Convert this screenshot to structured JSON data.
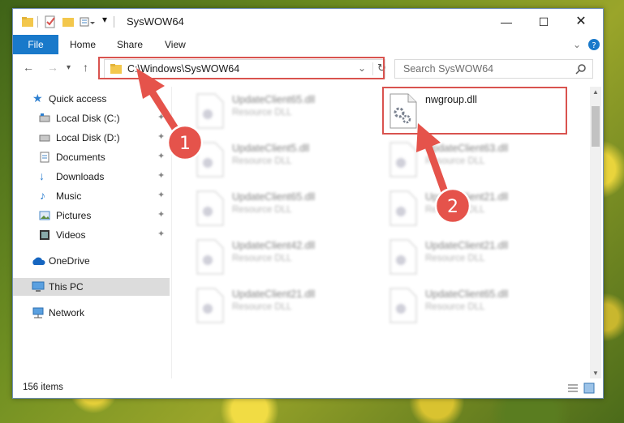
{
  "window": {
    "title": "SysWOW64"
  },
  "ribbon": {
    "file": "File",
    "home": "Home",
    "share": "Share",
    "view": "View"
  },
  "address": {
    "path": "C:\\Windows\\SysWOW64",
    "search_placeholder": "Search SysWOW64"
  },
  "sidebar": {
    "items": [
      {
        "label": "Quick access"
      },
      {
        "label": "Local Disk (C:)"
      },
      {
        "label": "Local Disk (D:)"
      },
      {
        "label": "Documents"
      },
      {
        "label": "Downloads"
      },
      {
        "label": "Music"
      },
      {
        "label": "Pictures"
      },
      {
        "label": "Videos"
      },
      {
        "label": "OneDrive"
      },
      {
        "label": "This PC"
      },
      {
        "label": "Network"
      }
    ]
  },
  "files": [
    {
      "name": "UpdateClient65.dll",
      "type": "Resource DLL"
    },
    {
      "name": "nwgroup.dll",
      "type": ""
    },
    {
      "name": "UpdateClient5.dll",
      "type": "Resource DLL"
    },
    {
      "name": "UpdateClient63.dll",
      "type": "Resource DLL"
    },
    {
      "name": "UpdateClient65.dll",
      "type": "Resource DLL"
    },
    {
      "name": "UpdateClient21.dll",
      "type": "Resource DLL"
    },
    {
      "name": "UpdateClient42.dll",
      "type": "Resource DLL"
    },
    {
      "name": "UpdateClient21.dll",
      "type": "Resource DLL"
    },
    {
      "name": "UpdateClient21.dll",
      "type": "Resource DLL"
    },
    {
      "name": "UpdateClient65.dll",
      "type": "Resource DLL"
    }
  ],
  "status": {
    "count": "156 items"
  },
  "annotations": {
    "step1": "1",
    "step2": "2",
    "color": "#e5534b"
  }
}
